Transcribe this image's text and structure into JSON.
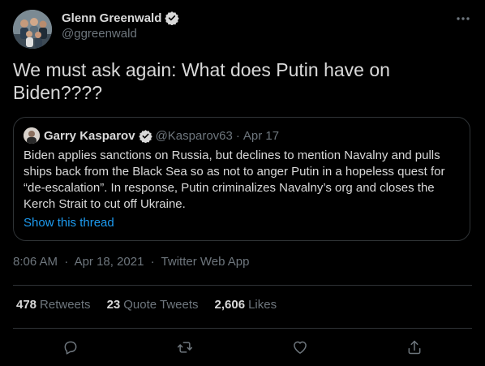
{
  "author": {
    "name": "Glenn Greenwald",
    "handle": "@ggreenwald",
    "verified_color": "#d9d9d9"
  },
  "tweet": {
    "text": "We must ask again: What does Putin have on Biden????"
  },
  "quoted_tweet": {
    "name": "Garry Kasparov",
    "handle": "@Kasparov63",
    "separator": "·",
    "date": "Apr 17",
    "text": "Biden applies sanctions on Russia, but declines to mention Navalny and pulls ships back from the Black Sea so as not to anger Putin in a hopeless quest for “de-escalation”. In response, Putin criminalizes Navalny’s org and closes the Kerch Strait to cut off Ukraine.",
    "show_thread_label": "Show this thread"
  },
  "meta": {
    "time": "8:06 AM",
    "date": "Apr 18, 2021",
    "source": "Twitter Web App",
    "separator": "·"
  },
  "stats": {
    "retweets": {
      "count": "478",
      "label": "Retweets"
    },
    "quote_tweets": {
      "count": "23",
      "label": "Quote Tweets"
    },
    "likes": {
      "count": "2,606",
      "label": "Likes"
    }
  },
  "actions": [
    "reply-icon",
    "retweet-icon",
    "like-icon",
    "share-icon"
  ],
  "colors": {
    "background": "#000000",
    "text": "#d9d9d9",
    "secondary": "#6e767d",
    "link": "#1d9bf0",
    "border": "#2f3336"
  }
}
